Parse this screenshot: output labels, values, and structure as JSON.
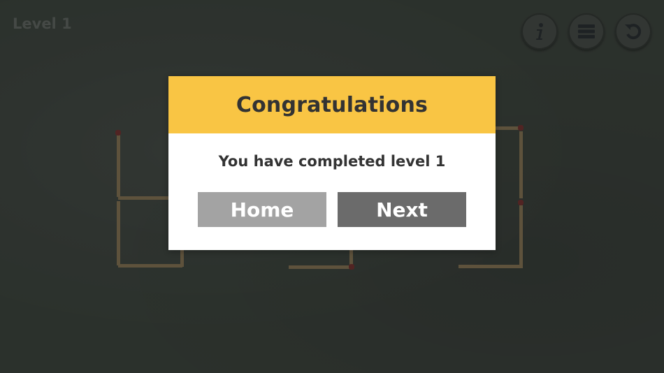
{
  "hud": {
    "level_label": "Level 1",
    "buttons": [
      {
        "name": "info",
        "icon": "info-icon"
      },
      {
        "name": "levels",
        "icon": "list-icon"
      },
      {
        "name": "restart",
        "icon": "restart-icon"
      }
    ]
  },
  "dialog": {
    "title": "Congratulations",
    "message": "You have completed level 1",
    "home_label": "Home",
    "next_label": "Next"
  },
  "colors": {
    "background": "#323833",
    "dialog_header": "#f9c544",
    "home_button": "#a3a3a3",
    "next_button": "#6b6b6b",
    "match_stick": "#6b5e45",
    "match_head": "#5d2a28"
  }
}
